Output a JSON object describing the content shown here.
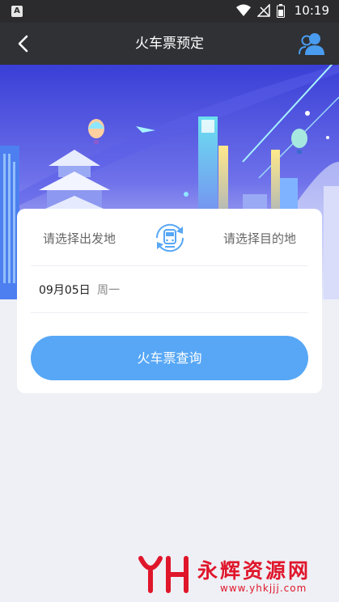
{
  "status_bar": {
    "app_icon_label": "A",
    "time": "10:19"
  },
  "nav": {
    "title": "火车票预定"
  },
  "route": {
    "from_placeholder": "请选择出发地",
    "to_placeholder": "请选择目的地"
  },
  "date": {
    "value": "09月05日",
    "weekday": "周一"
  },
  "search_button_label": "火车票查询",
  "watermark": {
    "text": "永辉资源网",
    "url": "www.yhkjjj.com"
  },
  "colors": {
    "accent": "#57a7f6",
    "nav_bg": "#2f3135",
    "page_bg": "#eef0f5",
    "watermark": "#e0162b"
  },
  "icons": {
    "back": "back-arrow-icon",
    "user": "user-group-icon",
    "swap": "train-swap-icon"
  }
}
